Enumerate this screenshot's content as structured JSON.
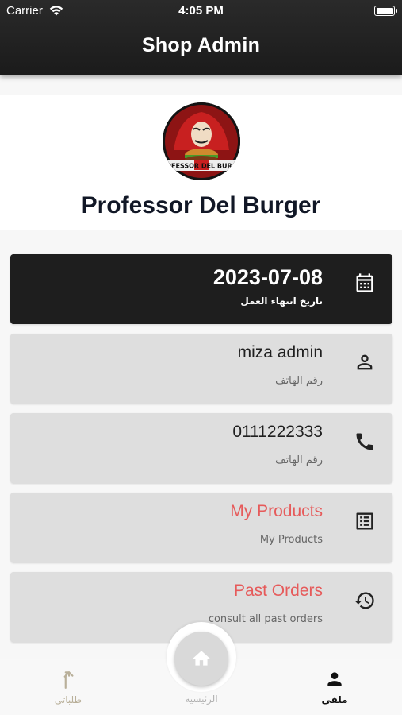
{
  "status_bar": {
    "carrier": "Carrier",
    "time": "4:05 PM"
  },
  "header": {
    "title": "Shop Admin"
  },
  "profile": {
    "shop_name": "Professor Del Burger",
    "avatar_logo_text": "PROFESSOR DEL BURGER"
  },
  "cards": {
    "expiry": {
      "value": "2023-07-08",
      "label": "تاريخ انتهاء العمل",
      "icon": "calendar-icon"
    },
    "user": {
      "value": "miza admin",
      "label": "رقم الهاتف",
      "icon": "person-icon"
    },
    "phone": {
      "value": "0111222333",
      "label": "رقم الهاتف",
      "icon": "phone-icon"
    },
    "products": {
      "value": "My Products",
      "label": "My Products",
      "icon": "list-icon"
    },
    "orders": {
      "value": "Past Orders",
      "label": "consult all past orders",
      "icon": "history-icon"
    }
  },
  "bottom_nav": {
    "orders_label": "طلباتي",
    "home_label": "الرئيسية",
    "profile_label": "ملفي"
  },
  "colors": {
    "accent": "#e65a5a",
    "header": "#1f1f1f",
    "card": "#dedede",
    "dark_card": "#1e1e1e"
  }
}
